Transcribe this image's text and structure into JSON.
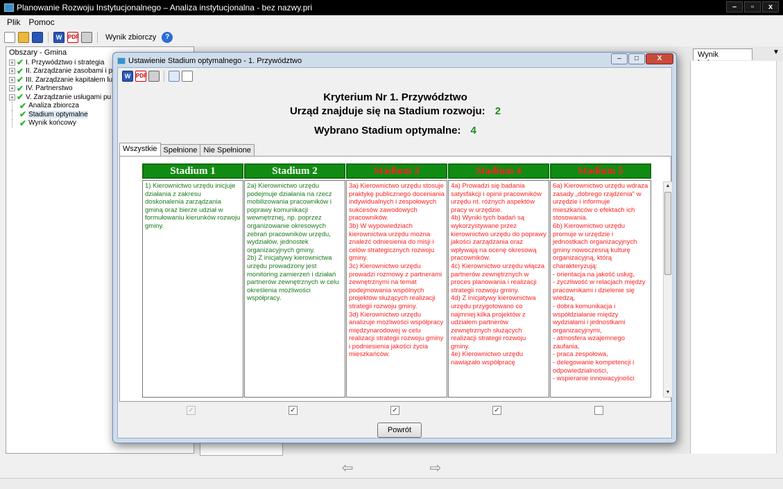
{
  "app": {
    "title": "Planowanie Rozwoju Instytucjonalnego – Analiza instytucjonalna - bez nazwy.pri",
    "window_buttons": [
      "–",
      "▫",
      "x"
    ]
  },
  "menu": [
    "Plik",
    "Pomoc"
  ],
  "toolbar": {
    "summary_label": "Wynik zbiorczy"
  },
  "left_panel": {
    "header": "Obszary - Gmina",
    "items": [
      {
        "label": "I. Przywództwo i strategia",
        "expandable": true
      },
      {
        "label": "II. Zarządzanie zasobami i p",
        "expandable": true
      },
      {
        "label": "III. Zarządzanie kapitałem lu",
        "expandable": true
      },
      {
        "label": "IV. Partnerstwo",
        "expandable": true
      },
      {
        "label": "V. Zarządzanie usługami pu",
        "expandable": true
      },
      {
        "label": "Analiza zbiorcza",
        "expandable": false
      },
      {
        "label": "Stadium optymalne",
        "expandable": false,
        "selected": true
      },
      {
        "label": "Wynik końcowy",
        "expandable": false
      }
    ]
  },
  "background": {
    "tab_fragment": "o",
    "tab_label": "Wynik końcowy",
    "tab_arrow": "▼"
  },
  "nav": {
    "back": "⇦",
    "forward": "⇨"
  },
  "dialog": {
    "title": "Ustawienie Stadium optymalnego - 1. Przywództwo",
    "buttons": [
      "–",
      "□",
      "X"
    ],
    "criterion": "Kryterium Nr 1. Przywództwo",
    "current_stage_label": "Urząd znajduje się na Stadium rozwoju:",
    "current_stage_value": "2",
    "chosen_label": "Wybrano Stadium optymalne:",
    "chosen_value": "4",
    "tabs": [
      "Wszystkie",
      "Spełnione",
      "Nie Spełnione"
    ],
    "back_button": "Powrót",
    "colors": {
      "header_bg": "#118c12",
      "met_text": "#1a7a1a",
      "unmet_text": "#ff2020",
      "header_met_text": "#ffffff",
      "header_unmet_text": "#ff2020"
    },
    "stages": [
      {
        "header": "Stadium 1",
        "met": true,
        "checked": true,
        "disabled": true,
        "text": "1) Kierownictwo urzędu inicjuje działania z zakresu doskonalenia zarządzania gminą oraz bierze udział w formułowaniu kierunków rozwoju gminy."
      },
      {
        "header": "Stadium 2",
        "met": true,
        "checked": true,
        "disabled": false,
        "text": "2a) Kierownictwo urzędu podejmuje działania na rzecz mobilizowania pracowników i poprawy komunikacji wewnętrznej, np. poprzez organizowanie okresowych zebrań pracowników urzędu, wydziałów, jednostek organizacyjnych gminy.\n2b) Z inicjatywy kierownictwa urzędu prowadzony jest monitoring zamierzeń i działań partnerów zewnętrznych w celu określenia możliwości współpracy."
      },
      {
        "header": "Stadium 3",
        "met": false,
        "checked": true,
        "disabled": false,
        "text": "3a) Kierownictwo urzędu stosuje praktykę publicznego doceniania indywidualnych i zespołowych sukcesów zawodowych pracowników.\n3b) W wypowiedziach kierownictwa urzędu można znaleźć odniesienia do misji i celów strategicznych rozwoju gminy.\n3c) Kierownictwo urzędu prowadzi rozmowy z partnerami zewnętrznymi na temat podejmowania wspólnych projektów służących realizacji strategii rozwoju gminy.\n3d) Kierownictwo urzędu analizuje możliwości współpracy międzynarodowej w celu realizacji strategii rozwoju gminy i podniesienia jakości życia mieszkańców."
      },
      {
        "header": "Stadium 4",
        "met": false,
        "checked": true,
        "disabled": false,
        "text": "4a) Prowadzi się badania satysfakcji i opinii pracowników urzędu nt. różnych aspektów pracy w urzędzie.\n4b) Wyniki tych badań są wykorzystywane przez kierownictwo urzędu do poprawy jakości zarządzania oraz wpływają na ocenę okresową pracowników.\n4c) Kierownictwo urzędu włącza partnerów zewnętrznych w proces planowania i realizacji strategii rozwoju gminy.\n4d) Z inicjatywy kierownictwa urzędu przygotowano co najmniej kilka projektów z udziałem partnerów zewnętrznych służących realizacji strategii rozwoju gminy.\n4e) Kierownictwo urzędu nawiązało współpracę"
      },
      {
        "header": "Stadium 5",
        "met": false,
        "checked": false,
        "disabled": false,
        "text": "6a) Kierownictwo urzędu wdraza zasady „dobrego rządzenia\" w urzędzie i informuje mieszkańców o efektach ich stosowania.\n6b) Kierownictwo urzędu promuje w urzędzie i jednostkach organizacyjnych gminy nowoczesną kulturę organizacyjną, którą charakteryzują:\n- orientacja na jakość usług,\n- życzliwość w relacjach między pracownikami i dzielenie się wiedzą,\n- dobra komunikacja i współdziałanie między wydziałami i jednostkami organizacyjnymi,\n- atmosfera wzajemnego zaufania,\n- praca zespołowa,\n- delegowanie kompetencji i odpowiedzialności,\n- wspieranie innowacyjności"
      }
    ]
  }
}
